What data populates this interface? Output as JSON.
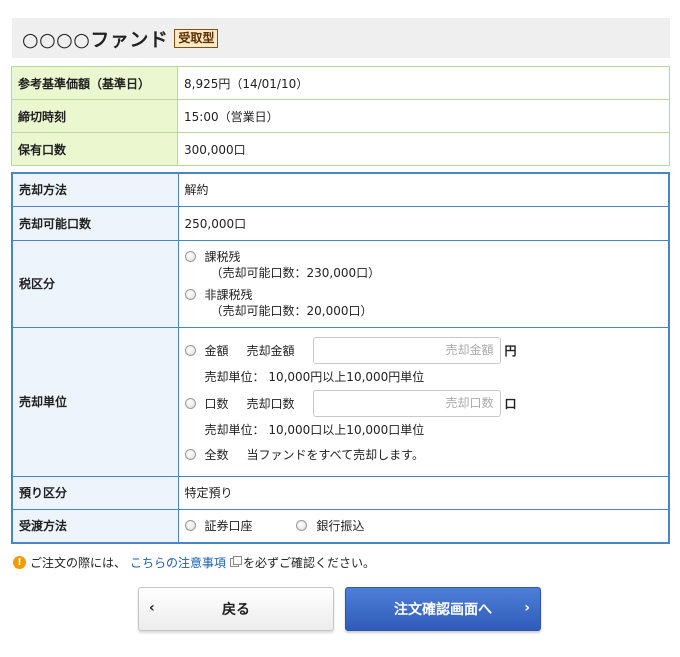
{
  "fund": {
    "name": "○○○○ファンド",
    "badge": "受取型"
  },
  "info": [
    {
      "label": "参考基準価額（基準日）",
      "value": "8,925円（14/01/10）"
    },
    {
      "label": "締切時刻",
      "value": "15:00（営業日）"
    },
    {
      "label": "保有口数",
      "value": "300,000口"
    }
  ],
  "order": {
    "method": {
      "label": "売却方法",
      "value": "解約"
    },
    "available": {
      "label": "売却可能口数",
      "value": "250,000口"
    },
    "tax": {
      "label": "税区分",
      "taxable": {
        "label": "課税残",
        "sub": "（売却可能口数：230,000口）"
      },
      "nontaxable": {
        "label": "非課税残",
        "sub": "（売却可能口数：20,000口）"
      }
    },
    "unit": {
      "label": "売却単位",
      "amount": {
        "label": "金額",
        "field_label": "売却金額",
        "placeholder": "売却金額",
        "suffix": "円",
        "note": "売却単位： 10,000円以上10,000円単位"
      },
      "shares": {
        "label": "口数",
        "field_label": "売却口数",
        "placeholder": "売却口数",
        "suffix": "口",
        "note": "売却単位： 10,000口以上10,000口単位"
      },
      "all": {
        "label": "全数",
        "desc": "当ファンドをすべて売却します。"
      }
    },
    "custody": {
      "label": "預り区分",
      "value": "特定預り"
    },
    "delivery": {
      "label": "受渡方法",
      "opt1": "証券口座",
      "opt2": "銀行振込"
    }
  },
  "notice": {
    "before": "ご注文の際には、",
    "link": "こちらの注意事項",
    "after": "を必ずご確認ください。"
  },
  "buttons": {
    "back": "戻る",
    "next": "注文確認画面へ"
  }
}
